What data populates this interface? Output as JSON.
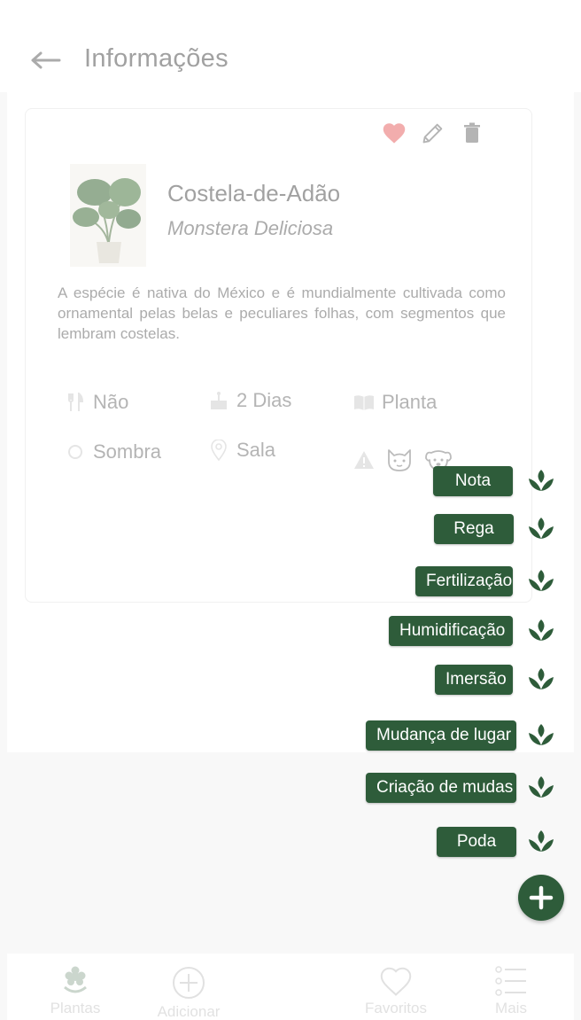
{
  "header": {
    "title": "Informações",
    "back_icon": "arrow-left-icon"
  },
  "card": {
    "actions": [
      {
        "name": "favorite-heart-icon",
        "color": "#e86a6a"
      },
      {
        "name": "edit-pencil-icon"
      },
      {
        "name": "delete-trash-icon"
      }
    ],
    "plant": {
      "common_name": "Costela-de-Adão",
      "scientific_name": "Monstera Deliciosa",
      "description": "A espécie é nativa do México e é mundialmente cultivada como ornamental pelas belas e peculiares folhas, com segmentos que lembram costelas."
    },
    "attributes": {
      "edible": "Não",
      "watering": "2 Dias",
      "type": "Planta",
      "light": "Sombra",
      "location": "Sala"
    }
  },
  "fab_menu": {
    "items": [
      "Nota",
      "Rega",
      "Fertilização",
      "Humidificação",
      "Imersão",
      "Mudança de lugar",
      "Criação de mudas",
      "Poda"
    ],
    "accent_color": "#2e5c3a"
  },
  "bottom_nav": {
    "items": [
      "Plantas",
      "Adicionar",
      "Favoritos",
      "Mais"
    ]
  }
}
